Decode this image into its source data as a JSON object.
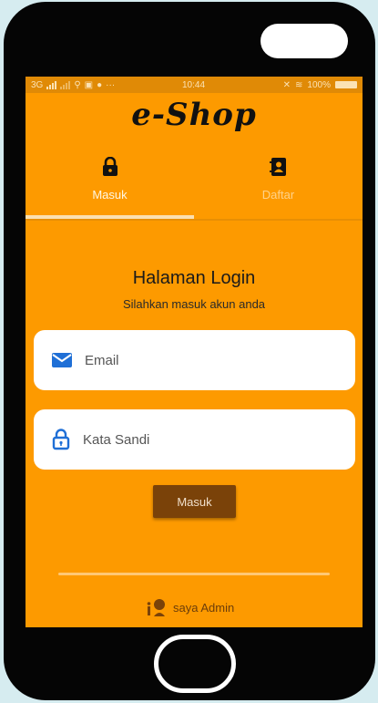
{
  "status_bar": {
    "network": "3G",
    "time": "10:44",
    "battery": "100%"
  },
  "app": {
    "title": "e-Shop"
  },
  "tabs": [
    {
      "label": "Masuk",
      "icon": "lock-icon",
      "active": true
    },
    {
      "label": "Daftar",
      "icon": "contact-book-icon",
      "active": false
    }
  ],
  "login": {
    "title": "Halaman Login",
    "subtitle": "Silahkan masuk akun anda",
    "email": {
      "placeholder": "Email",
      "value": "",
      "icon": "mail-icon"
    },
    "password": {
      "placeholder": "Kata Sandi",
      "value": "",
      "icon": "lock-icon"
    },
    "submit_label": "Masuk"
  },
  "footer": {
    "admin_label": "saya Admin",
    "icon": "admin-user-icon"
  },
  "colors": {
    "background": "#fd9a00",
    "status_bar": "#e08a06",
    "button": "#7a4209",
    "icon_blue": "#1f6fd6"
  }
}
